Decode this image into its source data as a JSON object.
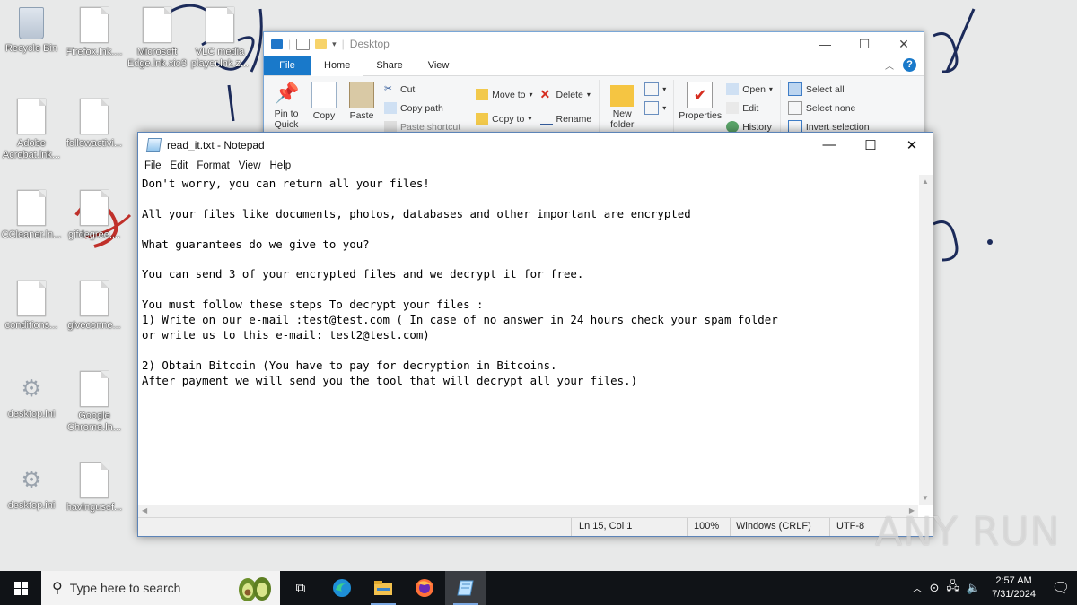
{
  "desktop": {
    "icons": [
      {
        "label": "Recycle Bin",
        "kind": "bin"
      },
      {
        "label": "Firefox.lnk....",
        "kind": "file"
      },
      {
        "label": "Microsoft Edge.lnk.xio3",
        "kind": "file"
      },
      {
        "label": "VLC media player.lnk.z...",
        "kind": "file"
      },
      {
        "label": "Adobe Acrobat.lnk...",
        "kind": "file"
      },
      {
        "label": "followactivi...",
        "kind": "file"
      },
      {
        "label": "CCleaner.ln...",
        "kind": "file"
      },
      {
        "label": "gifdegree....",
        "kind": "file"
      },
      {
        "label": "conditions...",
        "kind": "file"
      },
      {
        "label": "giveconne...",
        "kind": "file"
      },
      {
        "label": "desktop.ini",
        "kind": "gear"
      },
      {
        "label": "Google Chrome.ln...",
        "kind": "file"
      },
      {
        "label": "desktop.ini",
        "kind": "gear"
      },
      {
        "label": "havingusef...",
        "kind": "file"
      }
    ]
  },
  "explorer": {
    "title": "Desktop",
    "tabs": [
      "File",
      "Home",
      "Share",
      "View"
    ],
    "ribbon": {
      "pin_label": "Pin to Quick access",
      "copy_label": "Copy",
      "paste_label": "Paste",
      "cut_label": "Cut",
      "copy_path_label": "Copy path",
      "paste_shortcut_label": "Paste shortcut",
      "move_to_label": "Move to",
      "copy_to_label": "Copy to",
      "delete_label": "Delete",
      "rename_label": "Rename",
      "new_folder_label": "New folder",
      "properties_label": "Properties",
      "open_label": "Open",
      "edit_label": "Edit",
      "history_label": "History",
      "select_all_label": "Select all",
      "select_none_label": "Select none",
      "invert_selection_label": "Invert selection"
    }
  },
  "notepad": {
    "title": "read_it.txt - Notepad",
    "menu": [
      "File",
      "Edit",
      "Format",
      "View",
      "Help"
    ],
    "content": "Don't worry, you can return all your files!\n\nAll your files like documents, photos, databases and other important are encrypted\n\nWhat guarantees do we give to you?\n\nYou can send 3 of your encrypted files and we decrypt it for free.\n\nYou must follow these steps To decrypt your files :\n1) Write on our e-mail :test@test.com ( In case of no answer in 24 hours check your spam folder\nor write us to this e-mail: test2@test.com)\n\n2) Obtain Bitcoin (You have to pay for decryption in Bitcoins.\nAfter payment we will send you the tool that will decrypt all your files.)",
    "status": {
      "position": "Ln 15, Col 1",
      "zoom": "100%",
      "line_ending": "Windows (CRLF)",
      "encoding": "UTF-8"
    }
  },
  "watermark": "ANY RUN",
  "taskbar": {
    "search_placeholder": "Type here to search",
    "apps": [
      "task-view-icon",
      "edge-icon",
      "file-explorer-icon",
      "firefox-icon",
      "notepad-icon"
    ],
    "time": "2:57 AM",
    "date": "7/31/2024"
  },
  "colors": {
    "accent": "#1979ca",
    "taskbar": "#101317"
  }
}
